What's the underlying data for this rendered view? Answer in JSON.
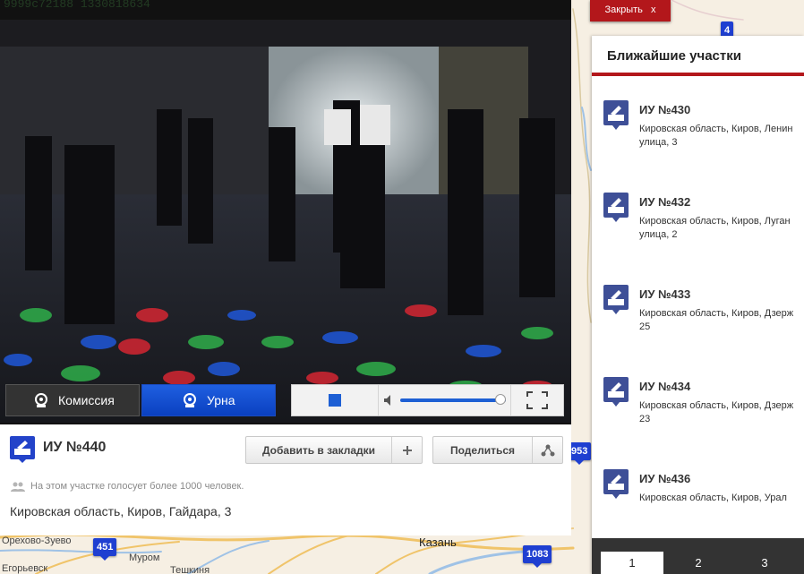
{
  "close_button": {
    "label": "Закрыть",
    "icon": "x"
  },
  "video": {
    "overlay_id": "9999c72188 1330818634",
    "tabs": [
      {
        "label": "Комиссия",
        "active": false
      },
      {
        "label": "Урна",
        "active": true
      }
    ],
    "volume_percent": 95
  },
  "station": {
    "title": "ИУ №440",
    "bookmark_label": "Добавить в закладки",
    "share_label": "Поделиться",
    "voters_note": "На этом участке голосует более 1000 человек.",
    "address": "Кировская область, Киров, Гайдара, 3"
  },
  "side": {
    "header": "Ближайшие участки",
    "stations": [
      {
        "title": "ИУ №430",
        "address_lines": [
          "Кировская область, Киров, Ленин",
          "улица, 3"
        ]
      },
      {
        "title": "ИУ №432",
        "address_lines": [
          "Кировская область, Киров, Луган",
          "улица, 2"
        ]
      },
      {
        "title": "ИУ №433",
        "address_lines": [
          "Кировская область, Киров, Дзерж",
          "25"
        ]
      },
      {
        "title": "ИУ №434",
        "address_lines": [
          "Кировская область, Киров, Дзерж",
          "23"
        ]
      },
      {
        "title": "ИУ №436",
        "address_lines": [
          "Кировская область, Киров, Урал",
          ""
        ]
      }
    ],
    "pages": [
      "1",
      "2",
      "3"
    ],
    "active_page": "1"
  },
  "map": {
    "labels": [
      "Орехово-Зуево",
      "Егорьевск",
      "Муром",
      "Казань",
      "Тешкиня"
    ],
    "markers": [
      "451",
      "1083",
      "4",
      "953"
    ]
  },
  "colors": {
    "accent": "#1f3fd1",
    "red": "#b3171b",
    "urn_blue": "#0a40c0"
  }
}
